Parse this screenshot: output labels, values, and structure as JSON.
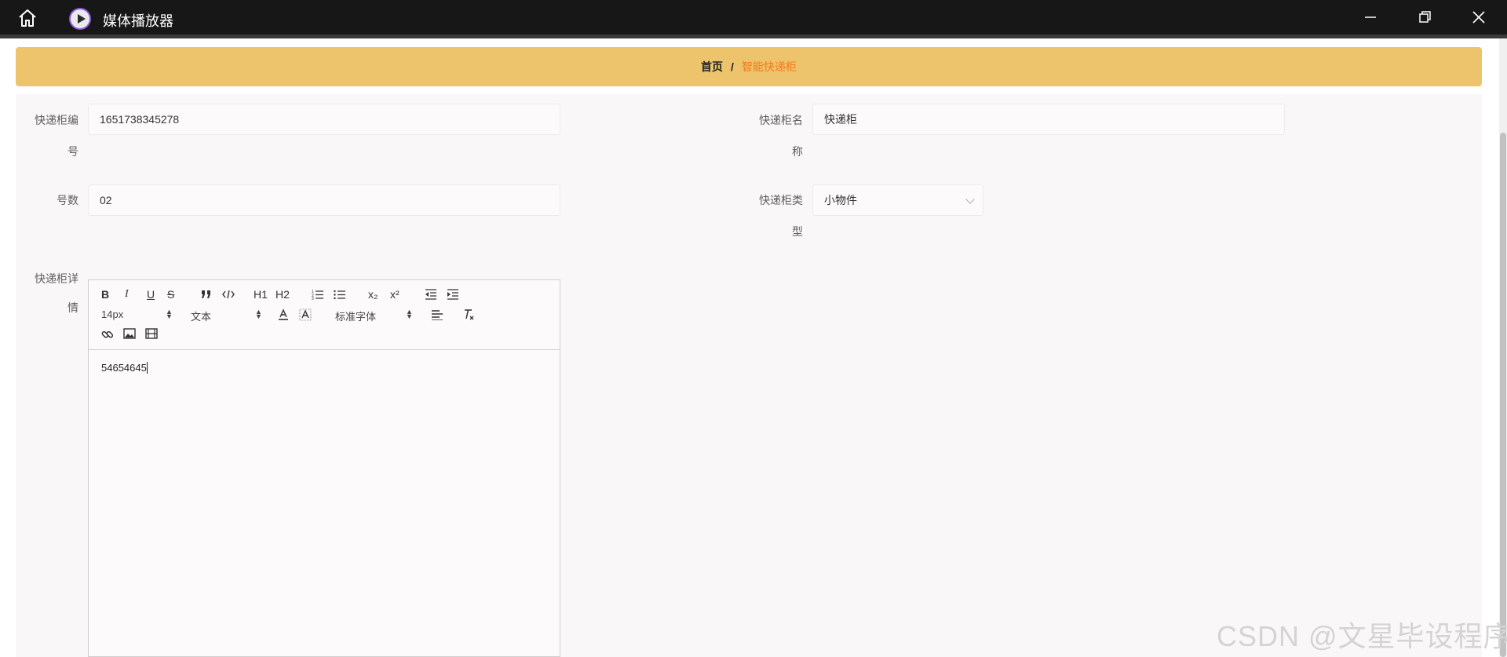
{
  "titlebar": {
    "app_title": "媒体播放器",
    "icons": [
      "home-icon",
      "media-player-logo-icon",
      "minimize-icon",
      "restore-icon",
      "close-icon"
    ]
  },
  "breadcrumb": {
    "home": "首页",
    "separator": "/",
    "current": "智能快递柜"
  },
  "form": {
    "cabinet_no": {
      "label_line1": "快递柜编",
      "label_line2": "号",
      "value": "1651738345278"
    },
    "cabinet_name": {
      "label_line1": "快递柜名",
      "label_line2": "称",
      "value": "快递柜"
    },
    "number": {
      "label": "号数",
      "value": "02"
    },
    "cabinet_type": {
      "label_line1": "快递柜类",
      "label_line2": "型",
      "value": "小物件"
    },
    "details": {
      "label_line1": "快递柜详",
      "label_line2": "情"
    }
  },
  "editor": {
    "font_size": "14px",
    "text_style": "文本",
    "font_family": "标准字体",
    "bold": "B",
    "italic": "I",
    "underline": "U",
    "strike": "S",
    "h1": "H1",
    "h2": "H2",
    "sub": "x₂",
    "sup": "x²",
    "content": "54654645"
  },
  "watermark": "CSDN @文星毕设程序",
  "colors": {
    "titlebar_bg": "#171717",
    "breadcrumb_bg": "#edc36b",
    "breadcrumb_active": "#f07c1e",
    "main_bg": "#faf7f8"
  }
}
